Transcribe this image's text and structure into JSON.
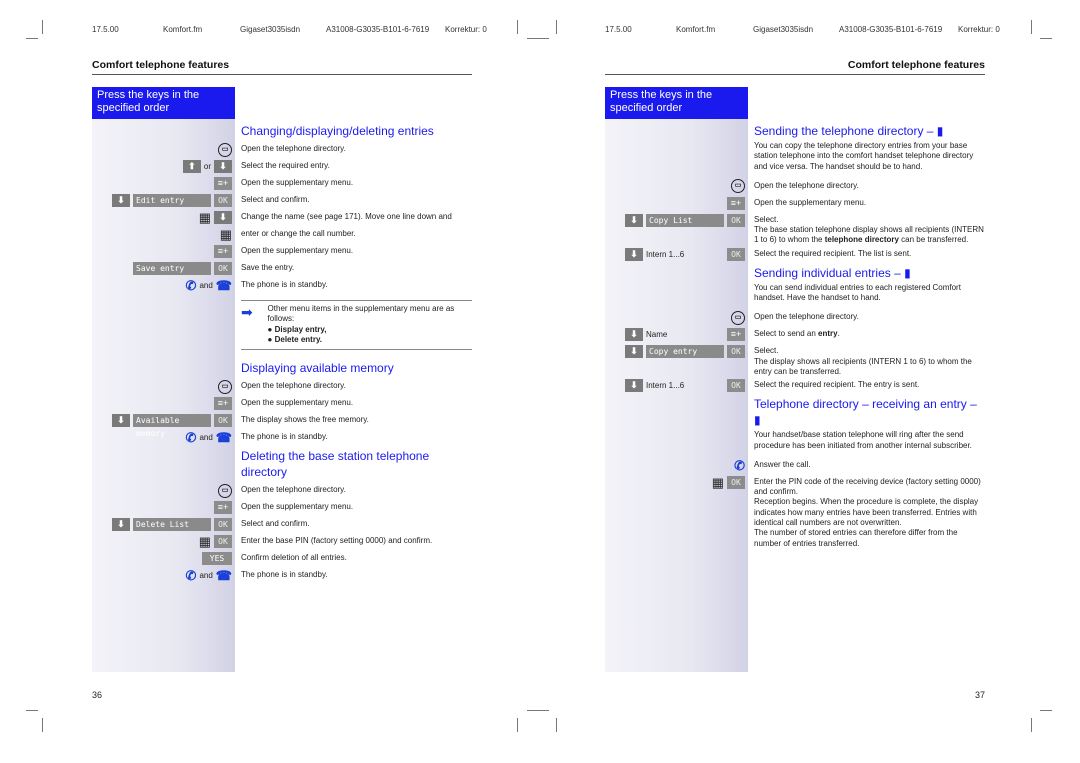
{
  "header": {
    "date": "17.5.00",
    "file": "Komfort.fm",
    "product": "Gigaset3035isdn",
    "docno": "A31008-G3035-B101-6-7619",
    "korrektur": "Korrektur: 0"
  },
  "section_title": "Comfort telephone features",
  "keys_box": "Press the keys in the specified order",
  "left": {
    "page_number": "36",
    "blocks": [
      {
        "type": "heading",
        "text": "Changing/displaying/deleting entries"
      },
      {
        "type": "row",
        "keys": [
          {
            "k": "book"
          }
        ],
        "text": "Open the telephone directory."
      },
      {
        "type": "row",
        "keys": [
          {
            "k": "up"
          },
          {
            "k": "word",
            "text": "or"
          },
          {
            "k": "down"
          }
        ],
        "text": "Select the required entry."
      },
      {
        "type": "row",
        "keys": [
          {
            "k": "menu"
          }
        ],
        "text": "Open the supplementary menu."
      },
      {
        "type": "row",
        "keys": [
          {
            "k": "down"
          },
          {
            "k": "disp",
            "text": "Edit entry"
          },
          {
            "k": "ok",
            "text": "OK"
          }
        ],
        "text": "Select and confirm."
      },
      {
        "type": "row",
        "keys": [
          {
            "k": "pad"
          },
          {
            "k": "down"
          }
        ],
        "text": "Change the name (see page 171). Move one line down and"
      },
      {
        "type": "row",
        "keys": [
          {
            "k": "pad"
          }
        ],
        "text": "enter or change the call number."
      },
      {
        "type": "row",
        "keys": [
          {
            "k": "menu"
          }
        ],
        "text": "Open the supplementary menu."
      },
      {
        "type": "row",
        "keys": [
          {
            "k": "disp",
            "text": "Save entry"
          },
          {
            "k": "ok",
            "text": "OK"
          }
        ],
        "text": "Save the entry."
      },
      {
        "type": "row",
        "keys": [
          {
            "k": "lift"
          },
          {
            "k": "word",
            "text": "and"
          },
          {
            "k": "hang"
          }
        ],
        "text": "The phone is in standby."
      },
      {
        "type": "note",
        "text": "Other menu items in the supplementary menu are as follows:",
        "items": [
          "Display entry,",
          "Delete entry."
        ]
      },
      {
        "type": "heading",
        "text": "Displaying available memory"
      },
      {
        "type": "row",
        "keys": [
          {
            "k": "book"
          }
        ],
        "text": "Open the telephone directory."
      },
      {
        "type": "row",
        "keys": [
          {
            "k": "menu"
          }
        ],
        "text": "Open the supplementary menu."
      },
      {
        "type": "row",
        "keys": [
          {
            "k": "down"
          },
          {
            "k": "disp",
            "text": "Available memory"
          },
          {
            "k": "ok",
            "text": "OK"
          }
        ],
        "text": "The display shows the free memory."
      },
      {
        "type": "row",
        "keys": [
          {
            "k": "lift"
          },
          {
            "k": "word",
            "text": "and"
          },
          {
            "k": "hang"
          }
        ],
        "text": "The phone is in standby."
      },
      {
        "type": "heading",
        "text": "Deleting the base station telephone directory"
      },
      {
        "type": "row",
        "keys": [
          {
            "k": "book"
          }
        ],
        "text": "Open the telephone directory."
      },
      {
        "type": "row",
        "keys": [
          {
            "k": "menu"
          }
        ],
        "text": "Open the supplementary menu."
      },
      {
        "type": "row",
        "keys": [
          {
            "k": "down"
          },
          {
            "k": "disp",
            "text": "Delete List"
          },
          {
            "k": "ok",
            "text": "OK"
          }
        ],
        "text": "Select and confirm."
      },
      {
        "type": "row",
        "keys": [
          {
            "k": "pad"
          },
          {
            "k": "ok",
            "text": "OK"
          }
        ],
        "text": "Enter the base PIN (factory setting 0000) and confirm."
      },
      {
        "type": "row",
        "keys": [
          {
            "k": "yes",
            "text": "YES"
          }
        ],
        "text": "Confirm deletion of all entries."
      },
      {
        "type": "row",
        "keys": [
          {
            "k": "lift"
          },
          {
            "k": "word",
            "text": "and"
          },
          {
            "k": "hang"
          }
        ],
        "text": "The phone is in standby."
      }
    ]
  },
  "right": {
    "page_number": "37",
    "blocks": [
      {
        "type": "heading",
        "text": "Sending the telephone directory – ▮"
      },
      {
        "type": "para",
        "text": "You can copy the telephone directory entries from your base station telephone into the comfort handset telephone directory and vice versa. The handset should be to hand."
      },
      {
        "type": "row",
        "keys": [
          {
            "k": "book"
          }
        ],
        "text": "Open the telephone directory."
      },
      {
        "type": "row",
        "keys": [
          {
            "k": "menu"
          }
        ],
        "text": "Open the supplementary menu."
      },
      {
        "type": "row",
        "keys": [
          {
            "k": "down"
          },
          {
            "k": "disp",
            "text": "Copy List"
          },
          {
            "k": "ok",
            "text": "OK"
          }
        ],
        "text": "Select.",
        "more": [
          "The base station telephone display shows all recipients (INTERN 1 to 6) to whom the ",
          {
            "b": "telephone directory"
          },
          " can be transferred."
        ]
      },
      {
        "type": "row",
        "keys": [
          {
            "k": "down"
          },
          {
            "k": "label",
            "text": "Intern 1...6"
          },
          {
            "k": "ok",
            "text": "OK"
          }
        ],
        "text": "Select the required recipient. The list is sent."
      },
      {
        "type": "heading",
        "text": "Sending individual entries – ▮"
      },
      {
        "type": "para",
        "text": "You can send individual entries to each registered Comfort handset. Have the handset to hand."
      },
      {
        "type": "row",
        "keys": [
          {
            "k": "book"
          }
        ],
        "text": "Open the telephone directory."
      },
      {
        "type": "row",
        "keys": [
          {
            "k": "down"
          },
          {
            "k": "label",
            "text": "Name"
          },
          {
            "k": "menu"
          }
        ],
        "text": "Select to send an ",
        "bold": "entry",
        "tail": "."
      },
      {
        "type": "row",
        "keys": [
          {
            "k": "down"
          },
          {
            "k": "disp",
            "text": "Copy entry"
          },
          {
            "k": "ok",
            "text": "OK"
          }
        ],
        "text": "Select.",
        "more": [
          "The display shows all recipients (INTERN 1 to 6) to whom the entry can be transferred."
        ]
      },
      {
        "type": "row",
        "keys": [
          {
            "k": "down"
          },
          {
            "k": "label",
            "text": "Intern 1...6"
          },
          {
            "k": "ok",
            "text": "OK"
          }
        ],
        "text": "Select the required recipient. The entry is sent."
      },
      {
        "type": "heading",
        "text": "Telephone directory – receiving an entry – ▮"
      },
      {
        "type": "para",
        "text": "Your handset/base station telephone will ring after the send procedure has been initiated from another internal subscriber."
      },
      {
        "type": "row",
        "keys": [
          {
            "k": "lift"
          }
        ],
        "text": "Answer the call."
      },
      {
        "type": "row",
        "keys": [
          {
            "k": "pad"
          },
          {
            "k": "ok",
            "text": "OK"
          }
        ],
        "text": "Enter the PIN code of the receiving device (factory setting 0000) and confirm.",
        "more": [
          "Reception begins. When the procedure is complete, the display indicates how many entries have been transferred. Entries with identical call numbers are not overwritten."
        ]
      },
      {
        "type": "para",
        "text": "The number of stored entries can therefore differ from the number of entries transferred."
      }
    ]
  }
}
